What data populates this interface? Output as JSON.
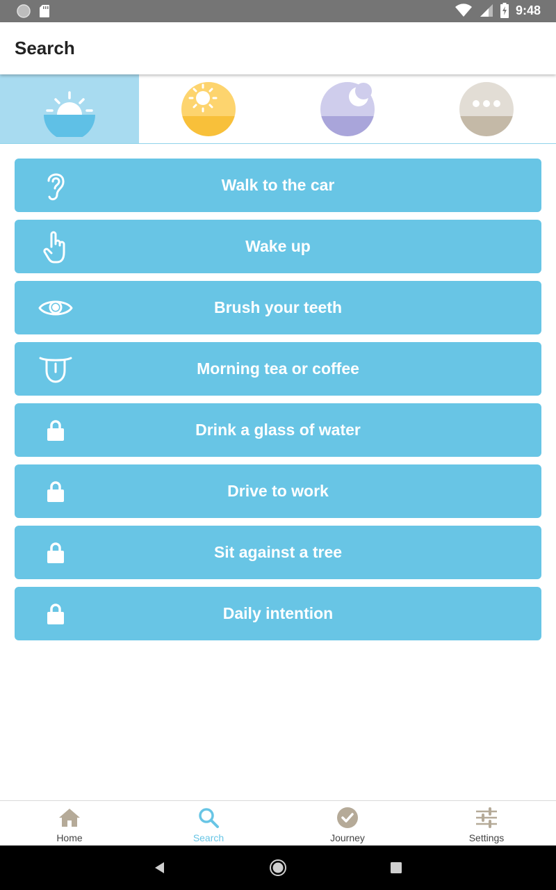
{
  "status_bar": {
    "time": "9:48",
    "icons": [
      "circle-notification-icon",
      "sd-card-icon",
      "wifi-icon",
      "signal-icon",
      "battery-charging-icon"
    ]
  },
  "app_bar": {
    "title": "Search"
  },
  "categories": [
    {
      "name": "morning",
      "icon": "sunrise-icon",
      "active": true
    },
    {
      "name": "day",
      "icon": "sun-icon",
      "active": false
    },
    {
      "name": "night",
      "icon": "moon-icon",
      "active": false
    },
    {
      "name": "other",
      "icon": "more-icon",
      "active": false
    }
  ],
  "activities": [
    {
      "label": "Walk to the car",
      "icon": "ear-icon"
    },
    {
      "label": "Wake up",
      "icon": "hand-pointer-icon"
    },
    {
      "label": "Brush your teeth",
      "icon": "eye-icon"
    },
    {
      "label": "Morning tea or coffee",
      "icon": "tongue-icon"
    },
    {
      "label": "Drink a glass of water",
      "icon": "lock-icon"
    },
    {
      "label": "Drive to work",
      "icon": "lock-icon"
    },
    {
      "label": "Sit against a tree",
      "icon": "lock-icon"
    },
    {
      "label": "Daily intention",
      "icon": "lock-icon"
    }
  ],
  "bottom_nav": [
    {
      "label": "Home",
      "icon": "home-icon",
      "active": false
    },
    {
      "label": "Search",
      "icon": "search-icon",
      "active": true
    },
    {
      "label": "Journey",
      "icon": "check-circle-icon",
      "active": false
    },
    {
      "label": "Settings",
      "icon": "sliders-icon",
      "active": false
    }
  ],
  "colors": {
    "accent": "#68c5e5",
    "active_tab_bg": "#a8dbf0",
    "nav_inactive_icon": "#b5aa98",
    "status_bar": "#757575"
  }
}
